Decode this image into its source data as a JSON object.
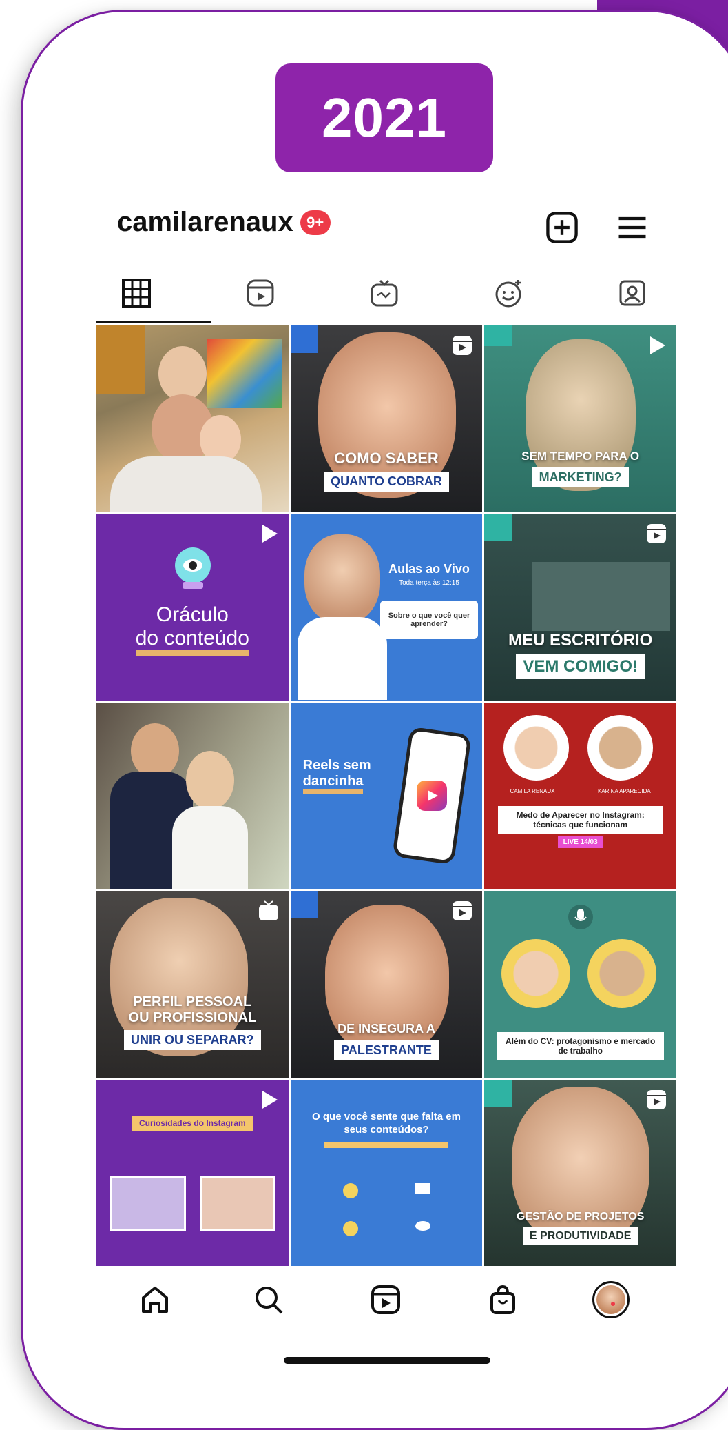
{
  "year_badge": "2021",
  "profile": {
    "username": "camilarenaux",
    "notification_count": "9+"
  },
  "tiles": [
    {
      "text": []
    },
    {
      "text": [
        "COMO SABER",
        "QUANTO COBRAR"
      ]
    },
    {
      "text": [
        "SEM TEMPO PARA O",
        "MARKETING?"
      ]
    },
    {
      "text": [
        "Oráculo",
        "do conteúdo"
      ]
    },
    {
      "text": [
        "Aulas ao Vivo",
        "Toda terça às 12:15",
        "Sobre o que você quer aprender?"
      ]
    },
    {
      "text": [
        "MEU ESCRITÓRIO",
        "VEM COMIGO!"
      ]
    },
    {
      "text": []
    },
    {
      "text": [
        "Reels sem",
        "dancinha"
      ]
    },
    {
      "text": [
        "CAMILA RENAUX",
        "KARINA APARECIDA",
        "Medo de Aparecer no Instagram: técnicas que funcionam",
        "LIVE 14/03"
      ]
    },
    {
      "text": [
        "PERFIL PESSOAL",
        "OU PROFISSIONAL",
        "UNIR OU SEPARAR?"
      ]
    },
    {
      "text": [
        "DE INSEGURA A",
        "PALESTRANTE"
      ]
    },
    {
      "text": [
        "Além do CV: protagonismo e mercado de trabalho"
      ]
    },
    {
      "text": [
        "Curiosidades do Instagram"
      ]
    },
    {
      "text": [
        "O que você sente que falta em seus conteúdos?"
      ]
    },
    {
      "text": [
        "GESTÃO DE PROJETOS",
        "E PRODUTIVIDADE"
      ]
    }
  ],
  "colors": {
    "accent_purple": "#8e24aa",
    "notification_red": "#ed3b48",
    "tile_purple": "#6d2aa7",
    "tile_teal": "#3e8e82",
    "tile_blue": "#3a7bd5",
    "tile_red": "#b5211f"
  }
}
